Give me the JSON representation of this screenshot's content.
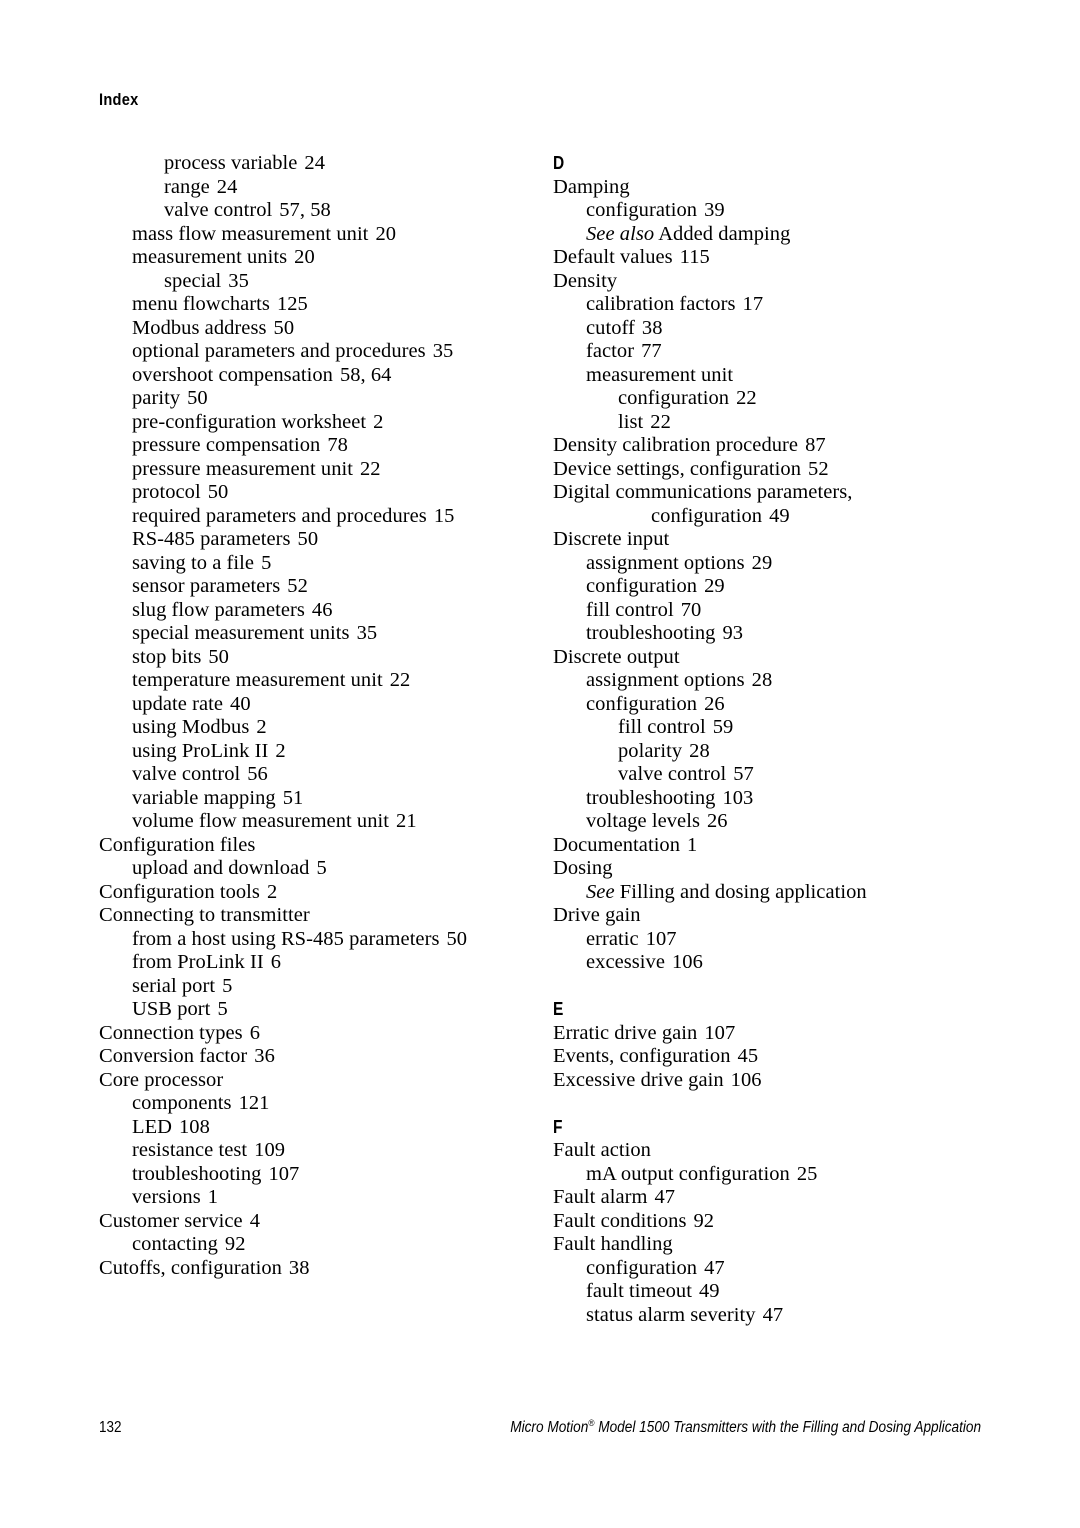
{
  "running_head": "Index",
  "footer": {
    "page_number": "132",
    "title_part1": "Micro Motion",
    "registered_mark": "®",
    "title_part2": " Model 1500 Transmitters with the Filling and Dosing Application"
  },
  "left_column": [
    {
      "type": "entry",
      "level": 1,
      "text": "process variable",
      "page": "24"
    },
    {
      "type": "entry",
      "level": 1,
      "text": "range",
      "page": "24"
    },
    {
      "type": "entry",
      "level": 1,
      "text": "valve control",
      "page": "57, 58"
    },
    {
      "type": "entry",
      "level": 0,
      "text": "mass flow measurement unit",
      "page": "20"
    },
    {
      "type": "entry",
      "level": 0,
      "text": "measurement units",
      "page": "20"
    },
    {
      "type": "entry",
      "level": 1,
      "text": "special",
      "page": "35"
    },
    {
      "type": "entry",
      "level": 0,
      "text": "menu flowcharts",
      "page": "125"
    },
    {
      "type": "entry",
      "level": 0,
      "text": "Modbus address",
      "page": "50"
    },
    {
      "type": "entry",
      "level": 0,
      "text": "optional parameters and procedures",
      "page": "35"
    },
    {
      "type": "entry",
      "level": 0,
      "text": "overshoot compensation",
      "page": "58, 64"
    },
    {
      "type": "entry",
      "level": 0,
      "text": "parity",
      "page": "50"
    },
    {
      "type": "entry",
      "level": 0,
      "text": "pre-configuration worksheet",
      "page": "2"
    },
    {
      "type": "entry",
      "level": 0,
      "text": "pressure compensation",
      "page": "78"
    },
    {
      "type": "entry",
      "level": 0,
      "text": "pressure measurement unit",
      "page": "22"
    },
    {
      "type": "entry",
      "level": 0,
      "text": "protocol",
      "page": "50"
    },
    {
      "type": "entry",
      "level": 0,
      "text": "required parameters and procedures",
      "page": "15"
    },
    {
      "type": "entry",
      "level": 0,
      "text": "RS-485 parameters",
      "page": "50"
    },
    {
      "type": "entry",
      "level": 0,
      "text": "saving to a file",
      "page": "5"
    },
    {
      "type": "entry",
      "level": 0,
      "text": "sensor parameters",
      "page": "52"
    },
    {
      "type": "entry",
      "level": 0,
      "text": "slug flow parameters",
      "page": "46"
    },
    {
      "type": "entry",
      "level": 0,
      "text": "special measurement units",
      "page": "35"
    },
    {
      "type": "entry",
      "level": 0,
      "text": "stop bits",
      "page": "50"
    },
    {
      "type": "entry",
      "level": 0,
      "text": "temperature measurement unit",
      "page": "22"
    },
    {
      "type": "entry",
      "level": 0,
      "text": "update rate",
      "page": "40"
    },
    {
      "type": "entry",
      "level": 0,
      "text": "using Modbus",
      "page": "2"
    },
    {
      "type": "entry",
      "level": 0,
      "text": "using ProLink II",
      "page": "2"
    },
    {
      "type": "entry",
      "level": 0,
      "text": "valve control",
      "page": "56"
    },
    {
      "type": "entry",
      "level": 0,
      "text": "variable mapping",
      "page": "51"
    },
    {
      "type": "entry",
      "level": 0,
      "text": "volume flow measurement unit",
      "page": "21"
    },
    {
      "type": "entry",
      "level": -1,
      "text": "Configuration files",
      "page": ""
    },
    {
      "type": "entry",
      "level": 0,
      "text": "upload and download",
      "page": "5"
    },
    {
      "type": "entry",
      "level": -1,
      "text": "Configuration tools",
      "page": "2"
    },
    {
      "type": "entry",
      "level": -1,
      "text": "Connecting to transmitter",
      "page": ""
    },
    {
      "type": "entry",
      "level": 0,
      "text": "from a host using RS-485 parameters",
      "page": "50"
    },
    {
      "type": "entry",
      "level": 0,
      "text": "from ProLink II",
      "page": "6"
    },
    {
      "type": "entry",
      "level": 0,
      "text": "serial port",
      "page": "5"
    },
    {
      "type": "entry",
      "level": 0,
      "text": "USB port",
      "page": "5"
    },
    {
      "type": "entry",
      "level": -1,
      "text": "Connection types",
      "page": "6"
    },
    {
      "type": "entry",
      "level": -1,
      "text": "Conversion factor",
      "page": "36"
    },
    {
      "type": "entry",
      "level": -1,
      "text": "Core processor",
      "page": ""
    },
    {
      "type": "entry",
      "level": 0,
      "text": "components",
      "page": "121"
    },
    {
      "type": "entry",
      "level": 0,
      "text": "LED",
      "page": "108"
    },
    {
      "type": "entry",
      "level": 0,
      "text": "resistance test",
      "page": "109"
    },
    {
      "type": "entry",
      "level": 0,
      "text": "troubleshooting",
      "page": "107"
    },
    {
      "type": "entry",
      "level": 0,
      "text": "versions",
      "page": "1"
    },
    {
      "type": "entry",
      "level": -1,
      "text": "Customer service",
      "page": "4"
    },
    {
      "type": "entry",
      "level": 0,
      "text": "contacting",
      "page": "92"
    },
    {
      "type": "entry",
      "level": -1,
      "text": "Cutoffs, configuration",
      "page": "38"
    }
  ],
  "right_column": [
    {
      "type": "letter",
      "text": "D"
    },
    {
      "type": "entry",
      "level": -1,
      "text": "Damping",
      "page": ""
    },
    {
      "type": "entry",
      "level": 0,
      "text": "configuration",
      "page": "39"
    },
    {
      "type": "xref",
      "level": 0,
      "prefix": "See also",
      "text": " Added damping"
    },
    {
      "type": "entry",
      "level": -1,
      "text": "Default values",
      "page": "115"
    },
    {
      "type": "entry",
      "level": -1,
      "text": "Density",
      "page": ""
    },
    {
      "type": "entry",
      "level": 0,
      "text": "calibration factors",
      "page": "17"
    },
    {
      "type": "entry",
      "level": 0,
      "text": "cutoff",
      "page": "38"
    },
    {
      "type": "entry",
      "level": 0,
      "text": "factor",
      "page": "77"
    },
    {
      "type": "entry",
      "level": 0,
      "text": "measurement unit",
      "page": ""
    },
    {
      "type": "entry",
      "level": 1,
      "text": "configuration",
      "page": "22"
    },
    {
      "type": "entry",
      "level": 1,
      "text": "list",
      "page": "22"
    },
    {
      "type": "entry",
      "level": -1,
      "text": "Density calibration procedure",
      "page": "87"
    },
    {
      "type": "entry",
      "level": -1,
      "text": "Device settings, configuration",
      "page": "52"
    },
    {
      "type": "entry",
      "level": -1,
      "text": "Digital communications parameters,",
      "page": ""
    },
    {
      "type": "entry",
      "level": 2,
      "text": "configuration",
      "page": "49"
    },
    {
      "type": "entry",
      "level": -1,
      "text": "Discrete input",
      "page": ""
    },
    {
      "type": "entry",
      "level": 0,
      "text": "assignment options",
      "page": "29"
    },
    {
      "type": "entry",
      "level": 0,
      "text": "configuration",
      "page": "29"
    },
    {
      "type": "entry",
      "level": 0,
      "text": "fill control",
      "page": "70"
    },
    {
      "type": "entry",
      "level": 0,
      "text": "troubleshooting",
      "page": "93"
    },
    {
      "type": "entry",
      "level": -1,
      "text": "Discrete output",
      "page": ""
    },
    {
      "type": "entry",
      "level": 0,
      "text": "assignment options",
      "page": "28"
    },
    {
      "type": "entry",
      "level": 0,
      "text": "configuration",
      "page": "26"
    },
    {
      "type": "entry",
      "level": 1,
      "text": "fill control",
      "page": "59"
    },
    {
      "type": "entry",
      "level": 1,
      "text": "polarity",
      "page": "28"
    },
    {
      "type": "entry",
      "level": 1,
      "text": "valve control",
      "page": "57"
    },
    {
      "type": "entry",
      "level": 0,
      "text": "troubleshooting",
      "page": "103"
    },
    {
      "type": "entry",
      "level": 0,
      "text": "voltage levels",
      "page": "26"
    },
    {
      "type": "entry",
      "level": -1,
      "text": "Documentation",
      "page": "1"
    },
    {
      "type": "entry",
      "level": -1,
      "text": "Dosing",
      "page": ""
    },
    {
      "type": "xref",
      "level": 0,
      "prefix": "See",
      "text": " Filling and dosing application"
    },
    {
      "type": "entry",
      "level": -1,
      "text": "Drive gain",
      "page": ""
    },
    {
      "type": "entry",
      "level": 0,
      "text": "erratic",
      "page": "107"
    },
    {
      "type": "entry",
      "level": 0,
      "text": "excessive",
      "page": "106"
    },
    {
      "type": "spacer"
    },
    {
      "type": "letter",
      "text": "E"
    },
    {
      "type": "entry",
      "level": -1,
      "text": "Erratic drive gain",
      "page": "107"
    },
    {
      "type": "entry",
      "level": -1,
      "text": "Events, configuration",
      "page": "45"
    },
    {
      "type": "entry",
      "level": -1,
      "text": "Excessive drive gain",
      "page": "106"
    },
    {
      "type": "spacer"
    },
    {
      "type": "letter",
      "text": "F"
    },
    {
      "type": "entry",
      "level": -1,
      "text": "Fault action",
      "page": ""
    },
    {
      "type": "entry",
      "level": 0,
      "text": "mA output configuration",
      "page": "25"
    },
    {
      "type": "entry",
      "level": -1,
      "text": "Fault alarm",
      "page": "47"
    },
    {
      "type": "entry",
      "level": -1,
      "text": "Fault conditions",
      "page": "92"
    },
    {
      "type": "entry",
      "level": -1,
      "text": "Fault handling",
      "page": ""
    },
    {
      "type": "entry",
      "level": 0,
      "text": "configuration",
      "page": "47"
    },
    {
      "type": "entry",
      "level": 0,
      "text": "fault timeout",
      "page": "49"
    },
    {
      "type": "entry",
      "level": 0,
      "text": "status alarm severity",
      "page": "47"
    }
  ]
}
